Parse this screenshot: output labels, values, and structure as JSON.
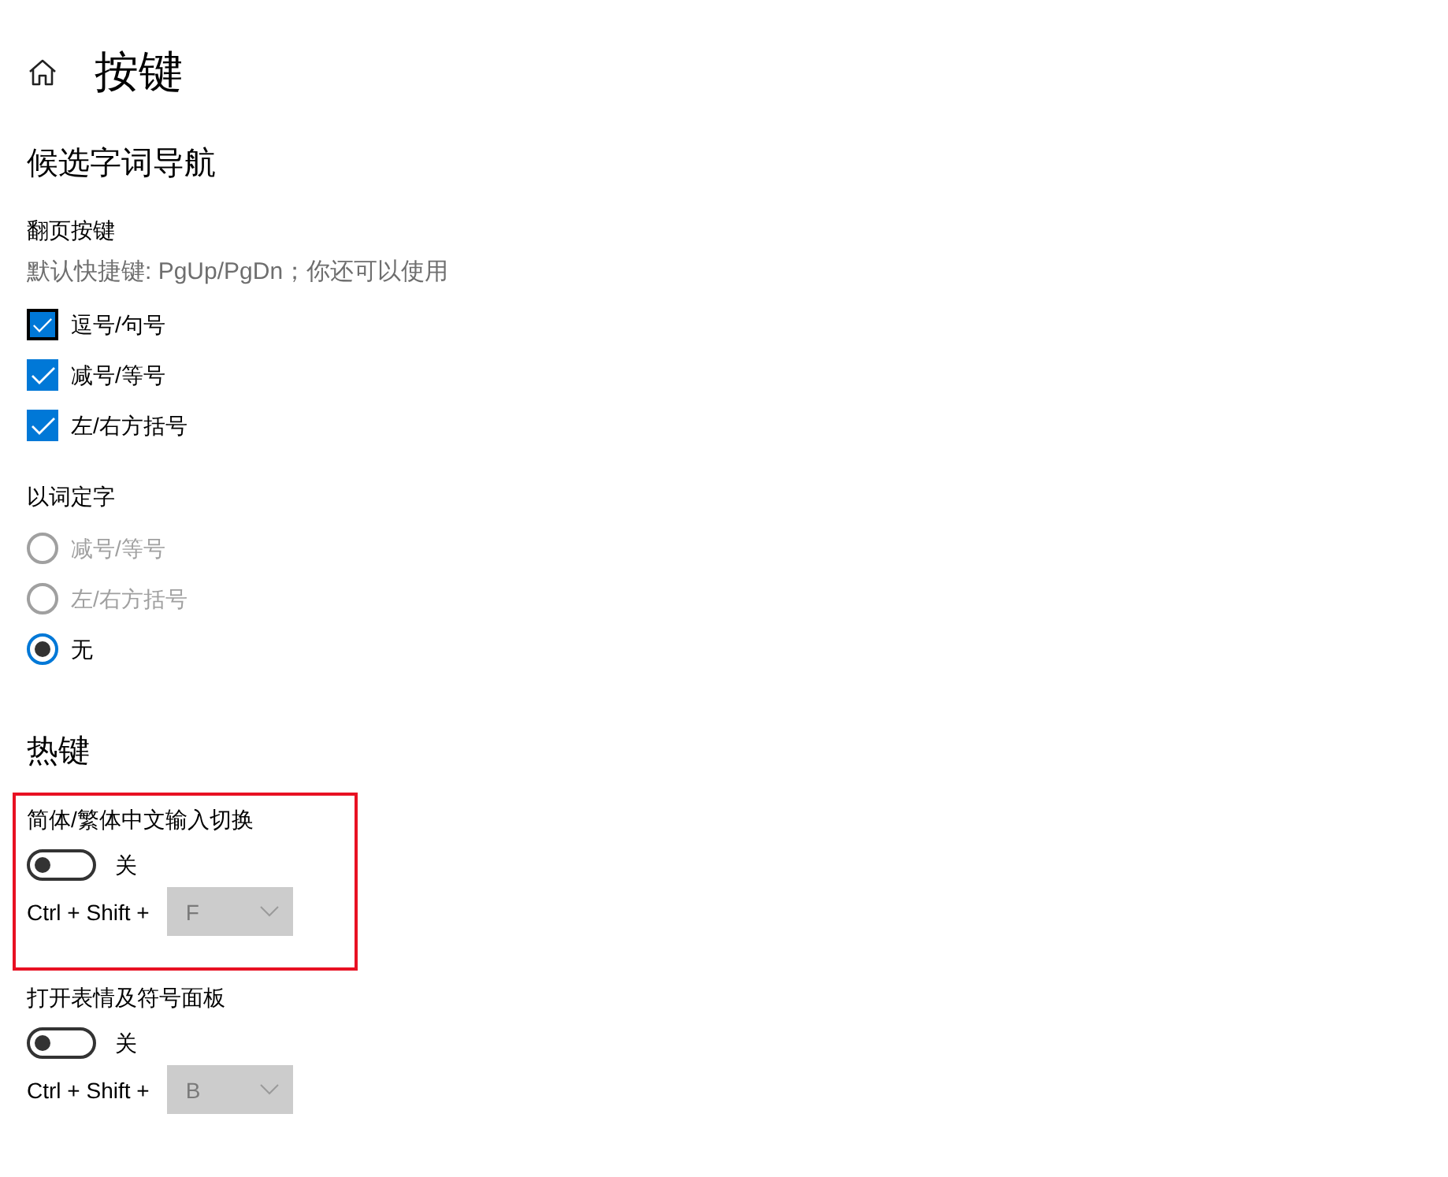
{
  "header": {
    "title": "按键"
  },
  "sections": [
    {
      "title": "候选字词导航",
      "groups": [
        {
          "kind": "checkboxes",
          "label": "翻页按键",
          "description": "默认快捷键: PgUp/PgDn；你还可以使用",
          "options": [
            {
              "label": "逗号/句号",
              "checked": true,
              "focused": true
            },
            {
              "label": "减号/等号",
              "checked": true,
              "focused": false
            },
            {
              "label": "左/右方括号",
              "checked": true,
              "focused": false
            }
          ]
        },
        {
          "kind": "radios",
          "label": "以词定字",
          "options": [
            {
              "label": "减号/等号",
              "selected": false,
              "disabled": true
            },
            {
              "label": "左/右方括号",
              "selected": false,
              "disabled": true
            },
            {
              "label": "无",
              "selected": true,
              "disabled": false
            }
          ]
        }
      ]
    },
    {
      "title": "热键",
      "groups": [
        {
          "kind": "hotkey",
          "label": "简体/繁体中文输入切换",
          "highlighted": true,
          "toggle": {
            "on": false,
            "state_label": "关"
          },
          "shortcut": {
            "prefix": "Ctrl + Shift +",
            "key": "F",
            "disabled": true
          }
        },
        {
          "kind": "hotkey",
          "label": "打开表情及符号面板",
          "highlighted": false,
          "toggle": {
            "on": false,
            "state_label": "关"
          },
          "shortcut": {
            "prefix": "Ctrl + Shift +",
            "key": "B",
            "disabled": true
          }
        }
      ]
    }
  ]
}
